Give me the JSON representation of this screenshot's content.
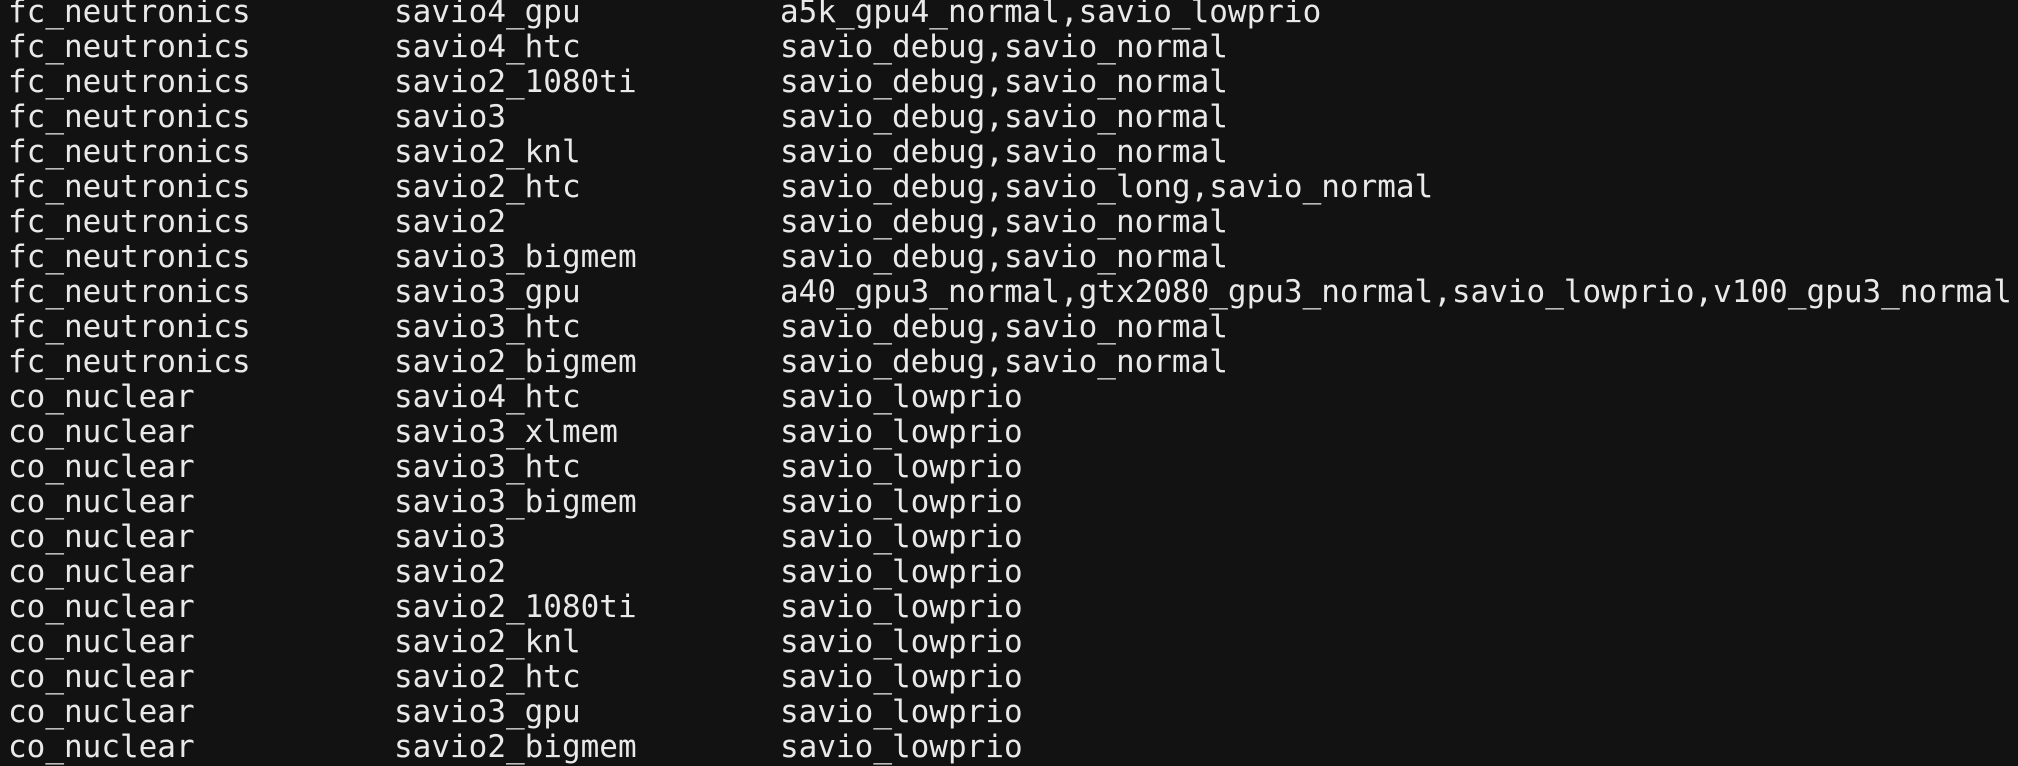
{
  "terminal": {
    "rows": [
      {
        "account": "fc_neutronics",
        "partition": "savio4_gpu",
        "qos": "a5k_gpu4_normal,savio_lowprio"
      },
      {
        "account": "fc_neutronics",
        "partition": "savio4_htc",
        "qos": "savio_debug,savio_normal"
      },
      {
        "account": "fc_neutronics",
        "partition": "savio2_1080ti",
        "qos": "savio_debug,savio_normal"
      },
      {
        "account": "fc_neutronics",
        "partition": "savio3",
        "qos": "savio_debug,savio_normal"
      },
      {
        "account": "fc_neutronics",
        "partition": "savio2_knl",
        "qos": "savio_debug,savio_normal"
      },
      {
        "account": "fc_neutronics",
        "partition": "savio2_htc",
        "qos": "savio_debug,savio_long,savio_normal"
      },
      {
        "account": "fc_neutronics",
        "partition": "savio2",
        "qos": "savio_debug,savio_normal"
      },
      {
        "account": "fc_neutronics",
        "partition": "savio3_bigmem",
        "qos": "savio_debug,savio_normal"
      },
      {
        "account": "fc_neutronics",
        "partition": "savio3_gpu",
        "qos": "a40_gpu3_normal,gtx2080_gpu3_normal,savio_lowprio,v100_gpu3_normal"
      },
      {
        "account": "fc_neutronics",
        "partition": "savio3_htc",
        "qos": "savio_debug,savio_normal"
      },
      {
        "account": "fc_neutronics",
        "partition": "savio2_bigmem",
        "qos": "savio_debug,savio_normal"
      },
      {
        "account": "co_nuclear",
        "partition": "savio4_htc",
        "qos": "savio_lowprio"
      },
      {
        "account": "co_nuclear",
        "partition": "savio3_xlmem",
        "qos": "savio_lowprio"
      },
      {
        "account": "co_nuclear",
        "partition": "savio3_htc",
        "qos": "savio_lowprio"
      },
      {
        "account": "co_nuclear",
        "partition": "savio3_bigmem",
        "qos": "savio_lowprio"
      },
      {
        "account": "co_nuclear",
        "partition": "savio3",
        "qos": "savio_lowprio"
      },
      {
        "account": "co_nuclear",
        "partition": "savio2",
        "qos": "savio_lowprio"
      },
      {
        "account": "co_nuclear",
        "partition": "savio2_1080ti",
        "qos": "savio_lowprio"
      },
      {
        "account": "co_nuclear",
        "partition": "savio2_knl",
        "qos": "savio_lowprio"
      },
      {
        "account": "co_nuclear",
        "partition": "savio2_htc",
        "qos": "savio_lowprio"
      },
      {
        "account": "co_nuclear",
        "partition": "savio3_gpu",
        "qos": "savio_lowprio"
      },
      {
        "account": "co_nuclear",
        "partition": "savio2_bigmem",
        "qos": "savio_lowprio"
      }
    ]
  }
}
